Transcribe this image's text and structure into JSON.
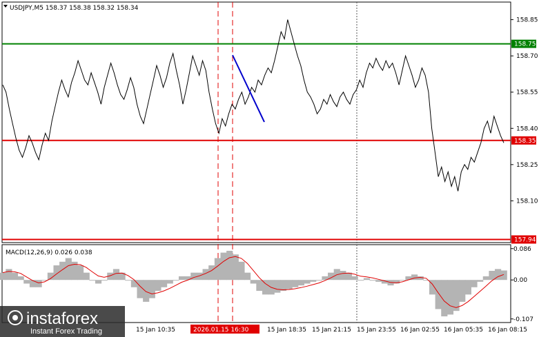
{
  "window": {
    "symbol_line": "USDJPY,M5  158.37 158.38 158.32 158.34",
    "macd_title": "MACD(12,26,9) 0.026 0.038"
  },
  "colors": {
    "background": "#ffffff",
    "price_line": "#000000",
    "resistance": "#008000",
    "support": "#e00000",
    "target": "#0000cc",
    "histogram": "#b4b4b4",
    "signal": "#e00000"
  },
  "price_axis": {
    "ticks": [
      "158.85",
      "158.70",
      "158.55",
      "158.40",
      "158.25",
      "158.10"
    ],
    "tick_values": [
      158.85,
      158.7,
      158.55,
      158.4,
      158.25,
      158.1
    ],
    "range": [
      157.93,
      158.92
    ],
    "levels": [
      {
        "label": "158.75",
        "value": 158.75,
        "kind": "resistance"
      },
      {
        "label": "158.35",
        "value": 158.35,
        "kind": "support"
      },
      {
        "label": "157.94",
        "value": 157.94,
        "kind": "support"
      }
    ]
  },
  "macd_axis": {
    "ticks": [
      "0.086",
      "0.00",
      "-0.107"
    ],
    "tick_values": [
      0.086,
      0.0,
      -0.107
    ],
    "range": [
      -0.115,
      0.095
    ]
  },
  "time_axis": {
    "labels": [
      "15 Jan 10:35",
      "15 Jan 18:35",
      "15 Jan 21:15",
      "15 Jan 23:55",
      "16 Jan 02:55",
      "16 Jan 05:35",
      "16 Jan 08:15"
    ],
    "highlight_label": "2026.01.15 16:30"
  },
  "watermark": {
    "brand": "instaforex",
    "tagline": "Instant Forex Trading"
  },
  "chart_data": {
    "type": "line",
    "title": "USDJPY,M5",
    "series": [
      {
        "name": "USDJPY,M5",
        "values": [
          158.58,
          158.55,
          158.48,
          158.42,
          158.36,
          158.31,
          158.28,
          158.32,
          158.37,
          158.34,
          158.3,
          158.27,
          158.33,
          158.38,
          158.35,
          158.43,
          158.49,
          158.55,
          158.6,
          158.56,
          158.53,
          158.59,
          158.63,
          158.68,
          158.64,
          158.6,
          158.58,
          158.63,
          158.59,
          158.55,
          158.5,
          158.57,
          158.62,
          158.67,
          158.63,
          158.58,
          158.54,
          158.52,
          158.56,
          158.61,
          158.57,
          158.5,
          158.45,
          158.42,
          158.48,
          158.54,
          158.6,
          158.66,
          158.62,
          158.57,
          158.61,
          158.67,
          158.71,
          158.64,
          158.58,
          158.5,
          158.56,
          158.63,
          158.7,
          158.66,
          158.62,
          158.68,
          158.64,
          158.55,
          158.48,
          158.42,
          158.38,
          158.44,
          158.41,
          158.46,
          158.5,
          158.48,
          158.52,
          158.55,
          158.5,
          158.53,
          158.57,
          158.55,
          158.6,
          158.58,
          158.62,
          158.65,
          158.63,
          158.68,
          158.74,
          158.8,
          158.77,
          158.85,
          158.8,
          158.75,
          158.7,
          158.66,
          158.6,
          158.55,
          158.53,
          158.5,
          158.46,
          158.48,
          158.52,
          158.5,
          158.54,
          158.51,
          158.49,
          158.53,
          158.55,
          158.52,
          158.5,
          158.54,
          158.56,
          158.6,
          158.57,
          158.63,
          158.67,
          158.65,
          158.69,
          158.66,
          158.64,
          158.68,
          158.65,
          158.67,
          158.63,
          158.58,
          158.64,
          158.7,
          158.66,
          158.62,
          158.57,
          158.6,
          158.65,
          158.62,
          158.55,
          158.4,
          158.3,
          158.2,
          158.24,
          158.18,
          158.22,
          158.16,
          158.2,
          158.14,
          158.22,
          158.25,
          158.23,
          158.28,
          158.26,
          158.3,
          158.34,
          158.4,
          158.43,
          158.38,
          158.45,
          158.41,
          158.37,
          158.34
        ]
      },
      {
        "name": "MACD(12,26,9)",
        "values": [
          0.02,
          0.03,
          0.02,
          0.01,
          -0.01,
          -0.02,
          -0.02,
          0.0,
          0.02,
          0.04,
          0.05,
          0.06,
          0.05,
          0.04,
          0.02,
          0.0,
          -0.01,
          0.0,
          0.02,
          0.03,
          0.02,
          0.0,
          -0.02,
          -0.05,
          -0.06,
          -0.05,
          -0.03,
          -0.02,
          -0.01,
          0.0,
          0.01,
          0.01,
          0.02,
          0.02,
          0.03,
          0.04,
          0.06,
          0.075,
          0.08,
          0.07,
          0.05,
          0.02,
          -0.01,
          -0.03,
          -0.04,
          -0.04,
          -0.035,
          -0.03,
          -0.025,
          -0.02,
          -0.015,
          -0.01,
          -0.005,
          0.0,
          0.01,
          0.02,
          0.03,
          0.025,
          0.02,
          0.01,
          0.0,
          0.005,
          0.0,
          -0.005,
          -0.01,
          -0.015,
          -0.01,
          0.0,
          0.01,
          0.015,
          0.01,
          0.0,
          -0.04,
          -0.08,
          -0.1,
          -0.095,
          -0.085,
          -0.06,
          -0.04,
          -0.02,
          -0.005,
          0.01,
          0.025,
          0.03,
          0.026
        ]
      }
    ],
    "ylim": [
      157.93,
      158.92
    ]
  }
}
